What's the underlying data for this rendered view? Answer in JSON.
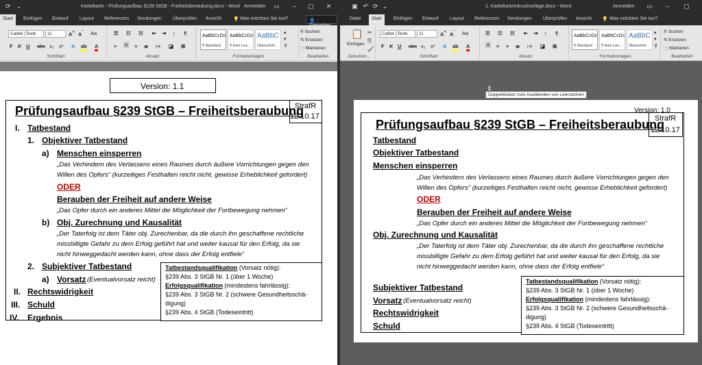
{
  "left_window": {
    "title": "Karteikarte - Prüfungsaufbau §239 StGB - Freiheitsberaubung.docx - Word",
    "signin": "Anmelden",
    "share": "Freigeben",
    "tell_me": "Was möchten Sie tun?",
    "tabs": [
      "Start",
      "Einfügen",
      "Entwurf",
      "Layout",
      "Referenzen",
      "Sendungen",
      "Überprüfen",
      "Ansicht"
    ],
    "font_name": "Calibri (Textk",
    "font_size": "11",
    "group_labels": [
      "Schriftart",
      "Absatz",
      "Formatvorlagen",
      "Bearbeiten"
    ],
    "styles": [
      {
        "preview": "AaBbCcDc",
        "name": "¶ Standard"
      },
      {
        "preview": "AaBbCcDc",
        "name": "¶ Kein Lee..."
      },
      {
        "preview": "AaBbC",
        "name": "Überschrif..."
      }
    ],
    "edit": [
      "Suchen",
      "Ersetzen",
      "Markieren"
    ],
    "doc": {
      "version": "Version: 1.1",
      "title": "Prüfungsaufbau §239 StGB – Freiheitsberaubung",
      "corner_tag": "StrafR",
      "corner_date": "12.10.17",
      "h1": "Tatbestand",
      "h1_num": "I.",
      "h2a_num": "1.",
      "h2a": "Objektiver Tatbestand",
      "h3a_num": "a)",
      "h3a": "Menschen einsperren",
      "q1_l1": "„Das Verhindern des Verlassens eines Raumes durch äußere Vorrichtungen gegen den",
      "q1_l2": "Willen des Opfers“ (kurzeitiges Festhalten reicht nicht, gewisse Erheblichkeit gefordert)",
      "oder": "ODER",
      "h3b": "Berauben der Freiheit auf andere Weise",
      "q2": "„Das Opfer durch ein anderes Mittel die Möglichkeit der Fortbewegung nehmen“",
      "h3c_num": "b)",
      "h3c": "Obj. Zurechnung und Kausalität",
      "q3_l1": "„Der Taterfolg ist dem Täter obj. Zurechenbar, da die durch ihn geschaffene rechtliche",
      "q3_l2": "missbilligte Gefahr zu dem Erfolg geführt hat und weiter kausal für den Erfolg, da sie",
      "q3_l3": "nicht hinweggedacht werden kann, ohne dass der Erfolg entfiele“",
      "h2b_num": "2.",
      "h2b": "Subjektiver Tatbestand",
      "h3d_num": "a)",
      "h3d": "Vorsatz",
      "h3d_note": "(Eventualvorsatz reicht)",
      "r2_num": "II.",
      "r2": "Rechtswidrigkeit",
      "r3_num": "III.",
      "r3": "Schuld",
      "r4_num": "IV.",
      "r4": "Ergebnis",
      "qbox_t1": "Tatbestandsqualifikation",
      "qbox_t1_note": " (Vorsatz nötig):",
      "qbox_l1": "§239 Abs. 3 StGB Nr. 1 (über 1 Woche)",
      "qbox_t2": "Erfolgsqualifikation",
      "qbox_t2_note": " (mindestens fahrlässig):",
      "qbox_l2": "§239 Abs. 3 StGB Nr. 2 (schwere Gesundheitsschä-",
      "qbox_l3": "digung)",
      "qbox_l4": "§239 Abs. 4 StGB (Todeseintritt)"
    }
  },
  "right_window": {
    "title": "1. Karteikartendruckvorlage.docx - Word",
    "signin": "Anmelden",
    "share": "Freigeben",
    "tell_me": "Was möchten Sie tun?",
    "tabs": [
      "Datei",
      "Start",
      "Einfügen",
      "Entwurf",
      "Layout",
      "Referenzen",
      "Sendungen",
      "Überprüfen",
      "Ansicht"
    ],
    "font_name": "Calibri (Textk",
    "font_size": "11",
    "paste_label": "Einfügen",
    "group_labels": [
      "Zwischen...",
      "Schriftart",
      "Absatz",
      "Formatvorlagen",
      "Bearbeiten"
    ],
    "styles": [
      {
        "preview": "AaBbCcDc",
        "name": "¶ Standard"
      },
      {
        "preview": "AaBbCcDc",
        "name": "¶ Kein Lee..."
      },
      {
        "preview": "AaBbC",
        "name": "Überschrif..."
      }
    ],
    "edit": [
      "Suchen",
      "Ersetzen",
      "Markieren"
    ],
    "tooltip": "Doppelklicken zum Ausblenden von Leerzeichen",
    "doc": {
      "version": "Version: 1.0",
      "title": "Prüfungsaufbau §239 StGB – Freiheitsberaubung",
      "corner_tag": "StrafR",
      "corner_date": "12.10.17",
      "h1": "Tatbestand",
      "h2": "Objektiver Tatbestand",
      "h3": "Menschen einsperren",
      "q1_l1": "„Das Verhindern des Verlassens eines Raumes durch äußere Vorrichtungen gegen den",
      "q1_l2": "Willen des Opfers“ (kurzeitiges Festhalten reicht nicht, gewisse Erheblichkeit gefordert)",
      "oder": "ODER",
      "h3b": "Berauben der Freiheit auf andere Weise",
      "q2": "„Das Opfer durch ein anderes Mittel die Möglichkeit der Fortbewegung nehmen“",
      "h3c": "Obj. Zurechnung und Kausalität",
      "q3_l1": "„Der Taterfolg ist dem Täter obj. Zurechenbar, da die durch ihn geschaffene rechtliche",
      "q3_l2": "missbilligte Gefahr zu dem Erfolg geführt hat und weiter kausal für den Erfolg, da sie",
      "q3_l3": "nicht hinweggedacht werden kann, ohne dass der Erfolg entfiele“",
      "h2b": "Subjektiver Tatbestand",
      "h3d": "Vorsatz",
      "h3d_note": "(Eventualvorsatz reicht)",
      "r2": "Rechtswidrigkeit",
      "r3": "Schuld",
      "qbox_t1": "Tatbestandsqualifikation",
      "qbox_t1_note": " (Vorsatz nötig):",
      "qbox_l1": "§239 Abs. 3 StGB Nr. 1 (über 1 Woche)",
      "qbox_t2": "Erfolgsqualifikation",
      "qbox_t2_note": " (mindestens fahrlässig):",
      "qbox_l2": "§239 Abs. 3 StGB Nr. 2 (schwere Gesundheitsschä-",
      "qbox_l3": "digung)",
      "qbox_l4": "§239 Abs. 4 StGB (Todeseintritt)"
    }
  }
}
